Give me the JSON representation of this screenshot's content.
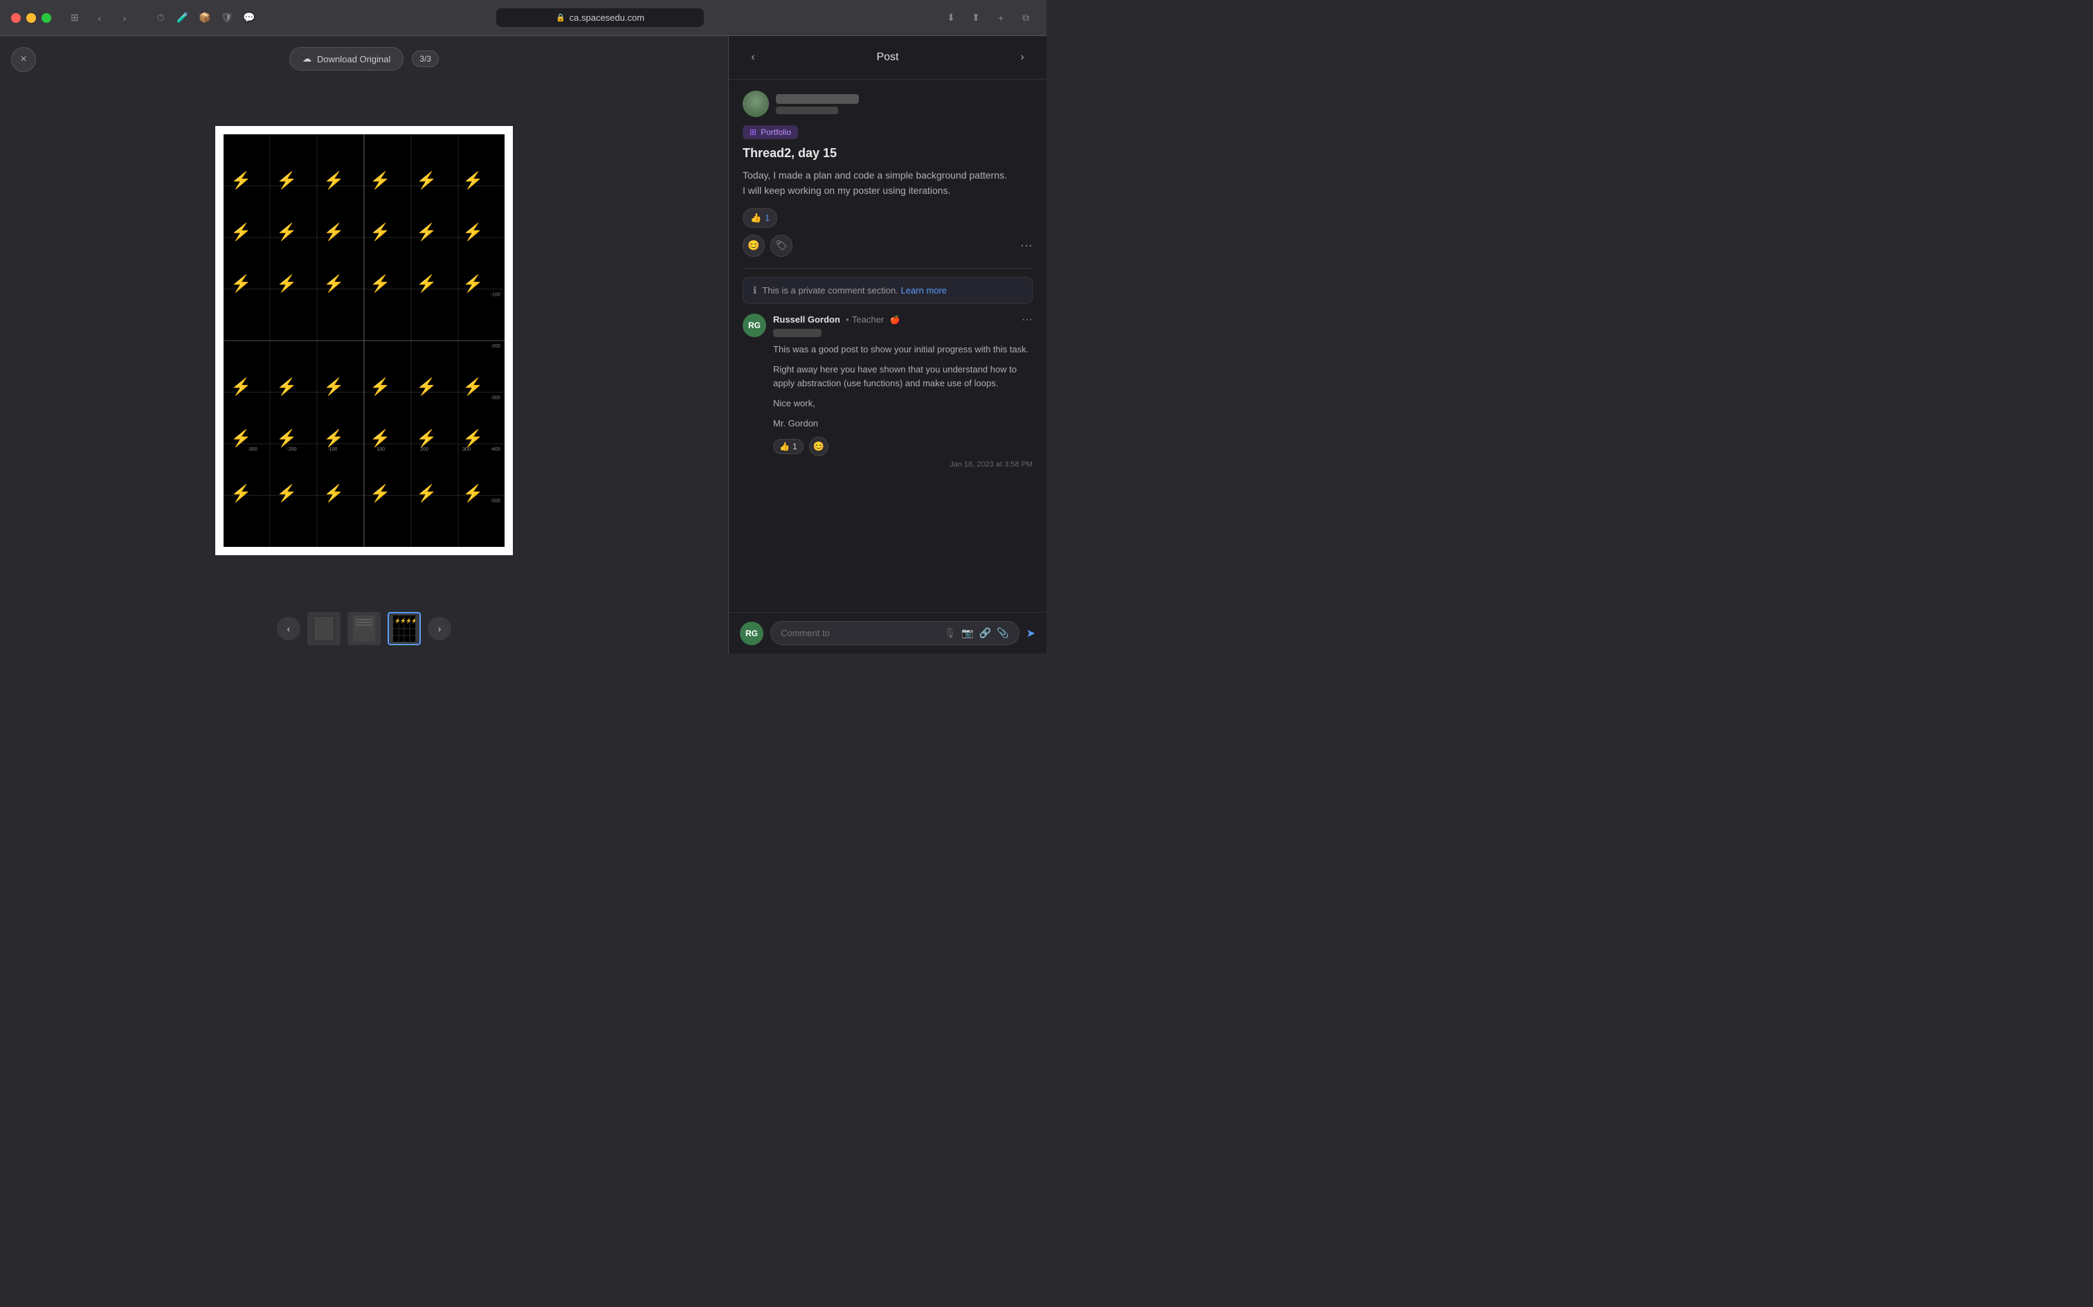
{
  "browser": {
    "url": "ca.spacesedu.com",
    "tab_title": "ca.spacesedu.com"
  },
  "toolbar": {
    "download_label": "Download Original",
    "page_counter": "3/3",
    "close_label": "×"
  },
  "panel": {
    "title": "Post",
    "prev_label": "‹",
    "next_label": "›"
  },
  "post": {
    "badge": "Portfolio",
    "title": "Thread2, day 15",
    "body_line1": "Today, I made a plan and code a simple background patterns.",
    "body_line2": "I will keep working on my poster using iterations.",
    "like_count": "1"
  },
  "private_notice": {
    "text": "This is a private comment section.",
    "learn_more": "Learn more"
  },
  "comment": {
    "author": "Russell Gordon",
    "role": "Teacher",
    "blurred_name": "",
    "body1": "This was a good post to show your initial progress with this task.",
    "body2": "Right away here you have shown that you understand how to apply abstraction (use functions) and make use of loops.",
    "body3": "Nice work,",
    "body4": "Mr. Gordon",
    "like_count": "1",
    "timestamp": "Jan 18, 2023 at 3:58 PM",
    "initials": "RG"
  },
  "comment_input": {
    "placeholder": "Comment to",
    "initials": "RG"
  },
  "thumbnails": {
    "prev": "‹",
    "next": "›"
  }
}
